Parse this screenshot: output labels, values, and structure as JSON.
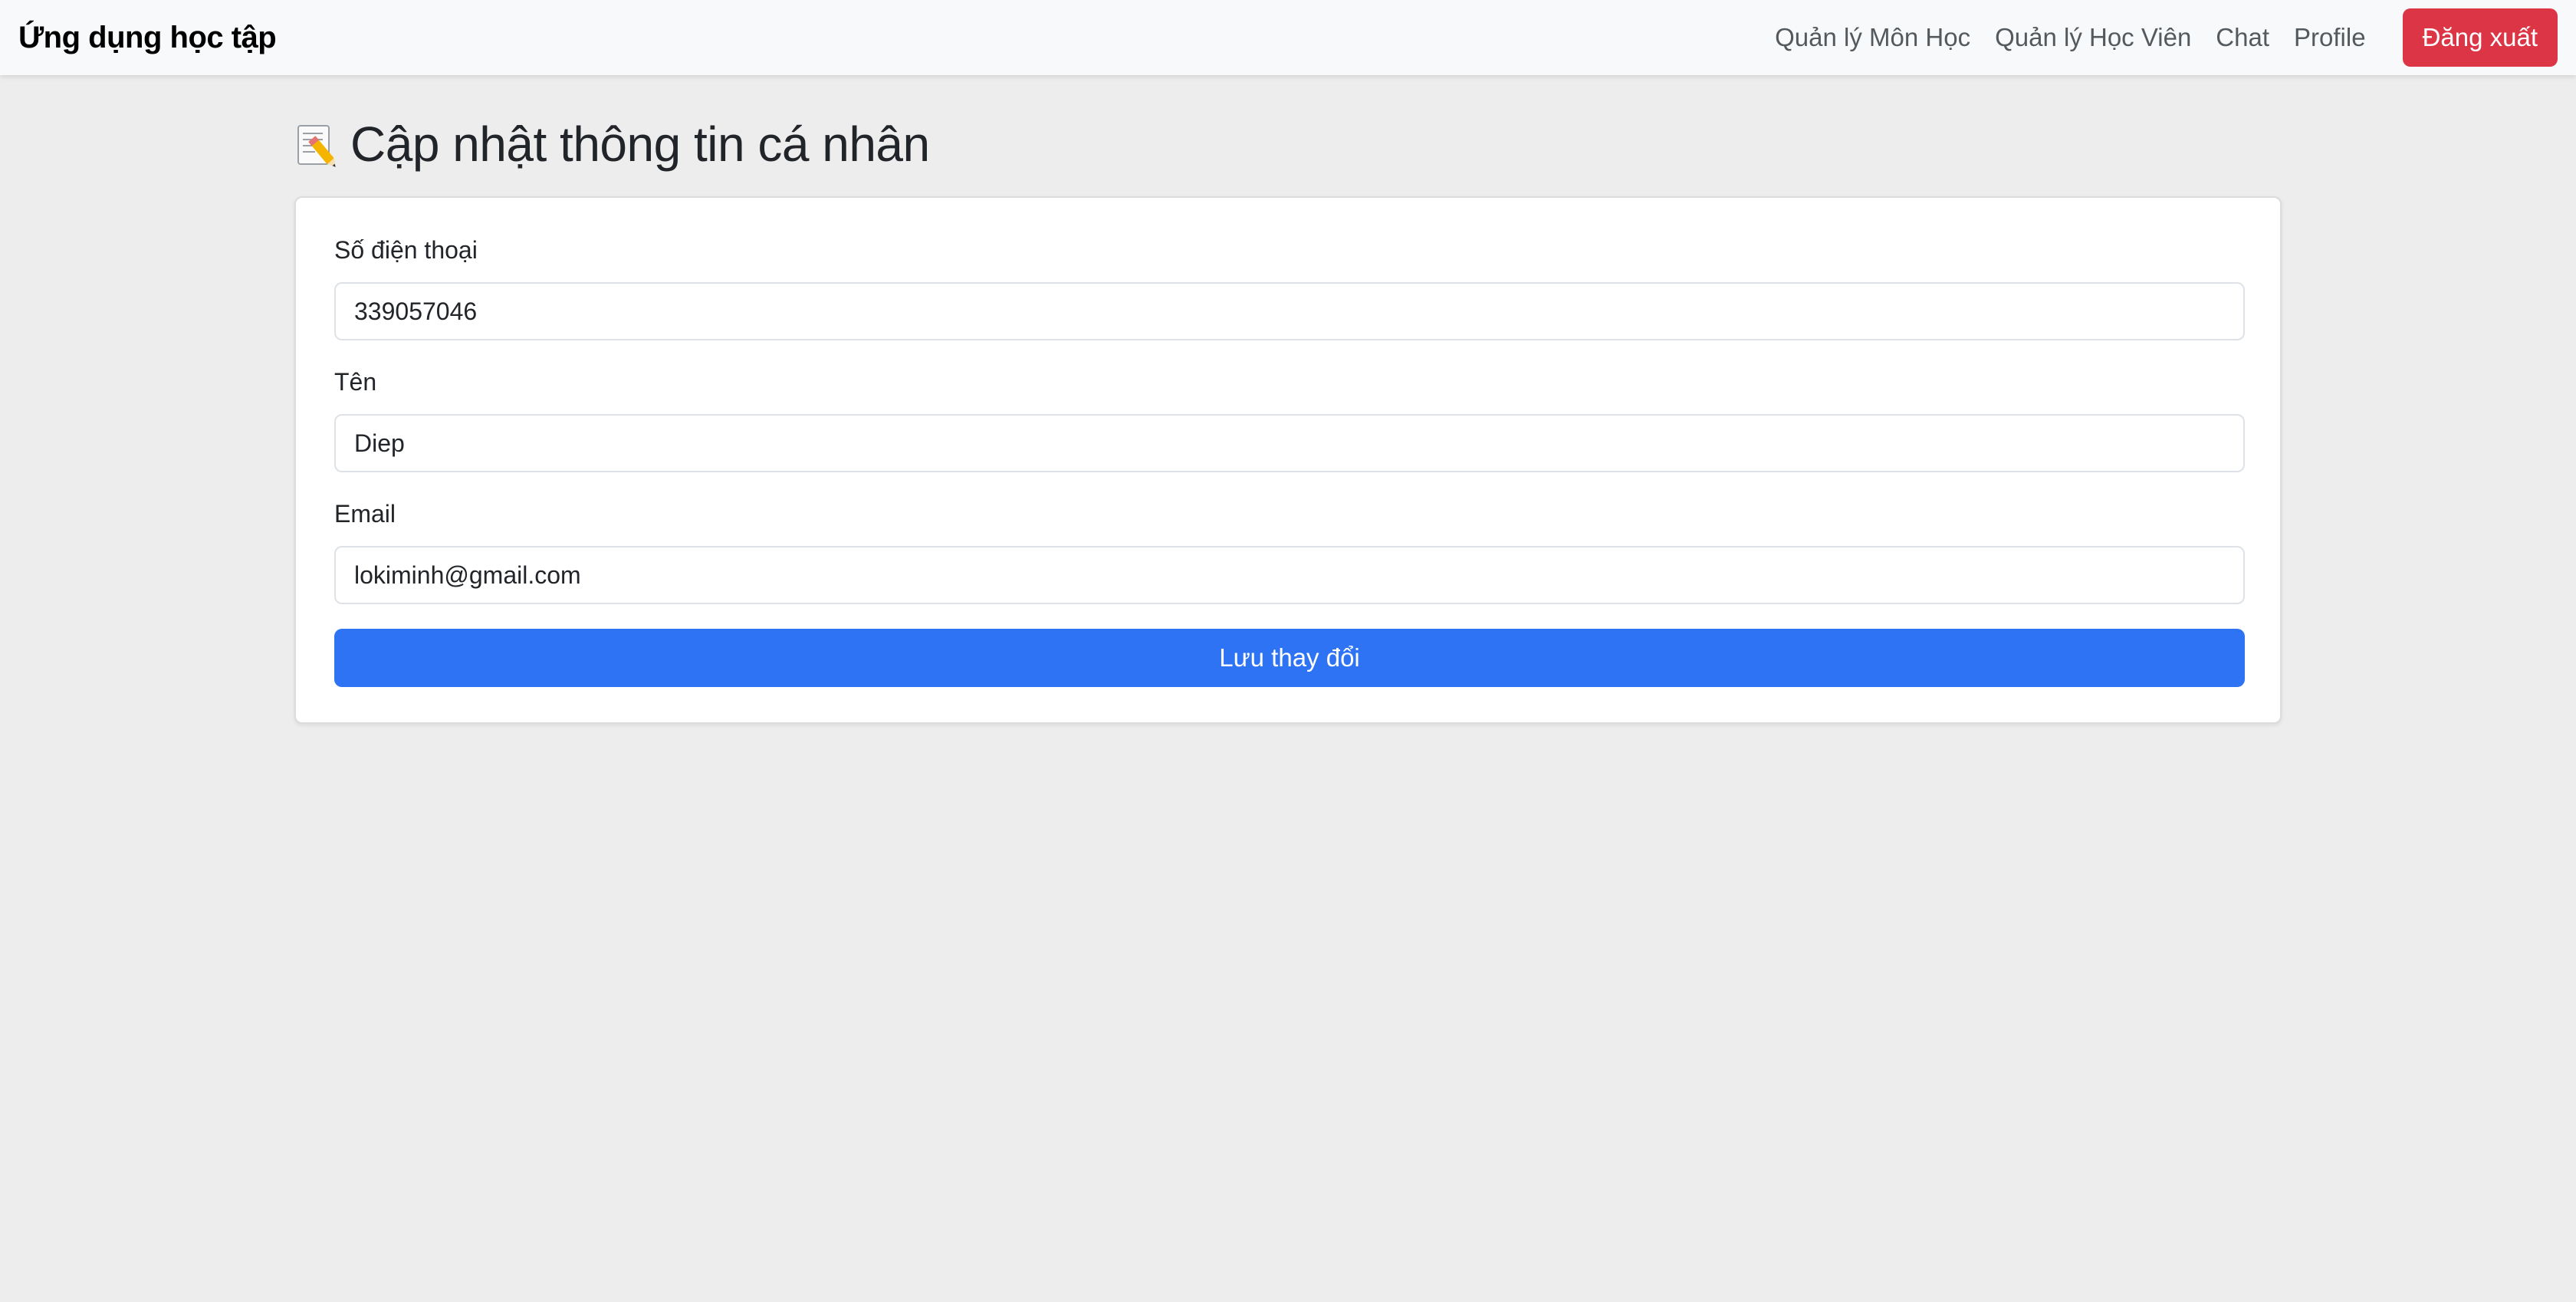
{
  "navbar": {
    "brand": "Ứng dụng học tập",
    "links": [
      "Quản lý Môn Học",
      "Quản lý Học Viên",
      "Chat",
      "Profile"
    ],
    "logout_label": "Đăng xuất",
    "logout_color": "#dc3545"
  },
  "page": {
    "icon": "memo-icon",
    "title": "Cập nhật thông tin cá nhân"
  },
  "form": {
    "phone": {
      "label": "Số điện thoại",
      "value": "339057046"
    },
    "name": {
      "label": "Tên",
      "value": "Diep"
    },
    "email": {
      "label": "Email",
      "value": "lokiminh@gmail.com"
    },
    "save_label": "Lưu thay đổi",
    "save_color": "#2d73f3"
  }
}
